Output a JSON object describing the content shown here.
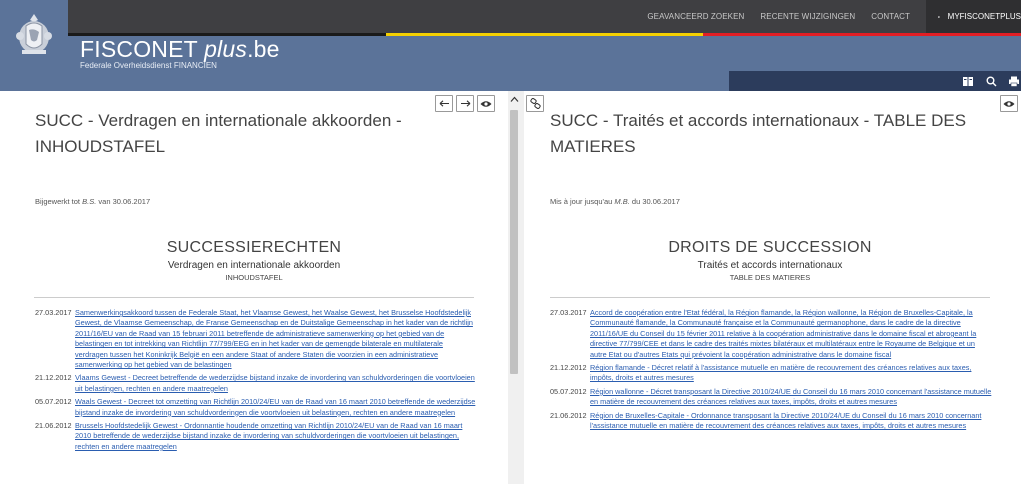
{
  "header": {
    "brand_title": "FISCONET",
    "brand_plus": "plus",
    "brand_tld": ".be",
    "brand_subtitle": "Federale Overheidsdienst FINANCIEN",
    "nav": [
      "GEAVANCEERD ZOEKEN",
      "RECENTE WIJZIGINGEN",
      "CONTACT"
    ],
    "user_label": "MYFISCONETPLUS",
    "colors": {
      "header_bg": "#5b7399",
      "topbar_bg": "#3f3f42",
      "search_bg": "#2c3c5c",
      "link": "#2a5db0"
    },
    "flag_colors": [
      "#1a1a1a",
      "#f5d000",
      "#e31e24"
    ]
  },
  "left": {
    "title": "SUCC - Verdragen en internationale akkoorden - INHOUDSTAFEL",
    "updated_prefix": "Bijgewerkt tot",
    "updated_source": "B.S.",
    "updated_suffix": "van 30.06.2017",
    "heading": "SUCCESSIERECHTEN",
    "subheading": "Verdragen en internationale akkoorden",
    "subsubheading": "INHOUDSTAFEL",
    "entries": [
      {
        "date": "27.03.2017",
        "text": "Samenwerkingsakkoord tussen de Federale Staat, het Vlaamse Gewest, het Waalse Gewest, het Brusselse Hoofdstedelijk Gewest, de Vlaamse Gemeenschap, de Franse Gemeenschap en de Duitstalige Gemeenschap in het kader van de richtlijn 2011/16/EU van de Raad van 15 februari 2011 betreffende de administratieve samenwerking op het gebied van de belastingen en tot intrekking van Richtlijn 77/799/EEG en in het kader van de gemengde bilaterale en multilaterale verdragen tussen het Koninkrijk België en een andere Staat of andere Staten die voorzien in een administratieve samenwerking op het gebied van de belastingen"
      },
      {
        "date": "21.12.2012",
        "text": "Vlaams Gewest - Decreet betreffende de wederzijdse bijstand inzake de invordering van schuldvorderingen die voortvloeien uit belastingen, rechten en andere maatregelen"
      },
      {
        "date": "05.07.2012",
        "text": "Waals Gewest - Decreet tot omzetting van Richtlijn 2010/24/EU van de Raad van 16 maart 2010 betreffende de wederzijdse bijstand inzake de invordering van schuldvorderingen die voortvloeien uit belastingen, rechten en andere maatregelen"
      },
      {
        "date": "21.06.2012",
        "text": "Brussels Hoofdstedelijk Gewest - Ordonnantie houdende omzetting van Richtlijn 2010/24/EU van de Raad van 16 maart 2010 betreffende de wederzijdse bijstand inzake de invordering van schuldvorderingen die voortvloeien uit belastingen, rechten en andere maatregelen"
      }
    ]
  },
  "right": {
    "title": "SUCC - Traités et accords internationaux - TABLE DES MATIERES",
    "updated_prefix": "Mis à jour jusqu'au",
    "updated_source": "M.B.",
    "updated_suffix": "du 30.06.2017",
    "heading": "DROITS DE SUCCESSION",
    "subheading": "Traités et accords internationaux",
    "subsubheading": "TABLE DES MATIERES",
    "entries": [
      {
        "date": "27.03.2017",
        "text": "Accord de coopération entre l'Etat fédéral, la Région flamande, la Région wallonne, la Région de Bruxelles-Capitale, la Communauté flamande, la Communauté française et la Communauté germanophone, dans le cadre de la directive 2011/16/UE du Conseil du 15 février 2011 relative à la coopération administrative dans le domaine fiscal et abrogeant la directive 77/799/CEE et dans le cadre des traités mixtes bilatéraux et multilatéraux entre le Royaume de Belgique et un autre Etat ou d'autres Etats qui prévoient la coopération administrative dans le domaine fiscal"
      },
      {
        "date": "21.12.2012",
        "text": "Région flamande - Décret relatif à l'assistance mutuelle en matière de recouvrement des créances relatives aux taxes, impôts, droits et autres mesures"
      },
      {
        "date": "05.07.2012",
        "text": "Région wallonne - Décret transposant la Directive 2010/24/UE du Conseil du 16 mars 2010 concernant l'assistance mutuelle en matière de recouvrement des créances relatives aux taxes, impôts, droits et autres mesures"
      },
      {
        "date": "21.06.2012",
        "text": "Région de Bruxelles-Capitale - Ordonnance transposant la Directive 2010/24/UE du Conseil du 16 mars 2010 concernant l'assistance mutuelle en matière de recouvrement des créances relatives aux taxes, impôts, droits et autres mesures"
      }
    ]
  }
}
